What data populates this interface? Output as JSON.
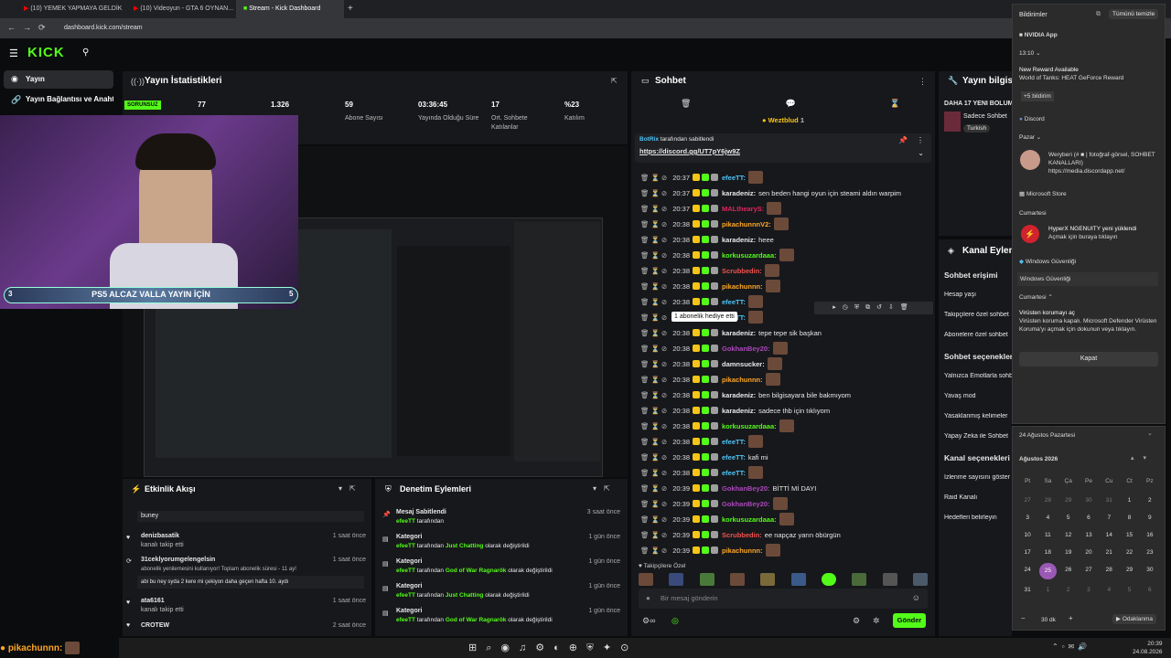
{
  "browser": {
    "tabs": [
      {
        "label": "(10) YEMEK YAPMAYA GELDİK"
      },
      {
        "label": "(10) Videoyun - GTA 6 OYNAN..."
      },
      {
        "label": "Stream - Kick Dashboard"
      }
    ],
    "url": "dashboard.kick.com/stream"
  },
  "sidebar": {
    "items": [
      {
        "label": "Yayın"
      },
      {
        "label": "Yayın Bağlantısı ve Anahtarı"
      }
    ]
  },
  "stats": {
    "title": "Yayın İstatistikleri",
    "status": "SORUNSUZ",
    "items": [
      {
        "value": "77",
        "label": ""
      },
      {
        "value": "1.326",
        "label": ""
      },
      {
        "value": "59",
        "label": "Abone Sayısı"
      },
      {
        "value": "03:36:45",
        "label": "Yayında Olduğu Süre"
      },
      {
        "value": "17",
        "label": "Ort. Sohbete Katılanlar"
      },
      {
        "value": "%23",
        "label": "Katılım"
      }
    ]
  },
  "overlay": {
    "goal_text": "PS5 ALCAZ VALLA YAYIN İÇİN",
    "goal_left": "3",
    "goal_right": "5"
  },
  "chat": {
    "title": "Sohbet",
    "top_user": "Weztblud",
    "top_count": "1",
    "pinned_by": "BotRix",
    "pinned_suffix": "tarafından sabitlendi",
    "pinned_link": "https://discord.gg/UT7pY6jw9Z",
    "tooltip": "1 abonelik hediye etti",
    "messages": [
      {
        "time": "20:37",
        "user": "efeeTT:",
        "color": "#4fc3f7",
        "text": "",
        "emote": true
      },
      {
        "time": "20:37",
        "user": "karadeniz:",
        "color": "#e8e8e8",
        "text": "sen beden hangi oyun için steami aldın warpim",
        "emote": false
      },
      {
        "time": "20:37",
        "user": "MALthearyS:",
        "color": "#e0245e",
        "text": "",
        "emote": true
      },
      {
        "time": "20:38",
        "user": "pikachunnnV2:",
        "color": "#ffa726",
        "text": "",
        "emote": true
      },
      {
        "time": "20:38",
        "user": "karadeniz:",
        "color": "#e8e8e8",
        "text": "heee",
        "emote": false
      },
      {
        "time": "20:38",
        "user": "korkusuzardaaa:",
        "color": "#53fc18",
        "text": "",
        "emote": true
      },
      {
        "time": "20:38",
        "user": "Scrubbedin:",
        "color": "#ef5350",
        "text": "",
        "emote": true
      },
      {
        "time": "20:38",
        "user": "pikachunnn:",
        "color": "#ffa726",
        "text": "",
        "emote": true
      },
      {
        "time": "20:38",
        "user": "efeeTT:",
        "color": "#4fc3f7",
        "text": "",
        "emote": true
      },
      {
        "time": "20:38",
        "user": "efeeTT:",
        "color": "#4fc3f7",
        "text": "",
        "emote": true
      },
      {
        "time": "20:38",
        "user": "karadeniz:",
        "color": "#e8e8e8",
        "text": "tepe tepe sik başkan",
        "emote": false
      },
      {
        "time": "20:38",
        "user": "GokhanBey20:",
        "color": "#ab47bc",
        "text": "",
        "emote": true
      },
      {
        "time": "20:38",
        "user": "damnsucker:",
        "color": "#e8e8e8",
        "text": "",
        "emote": true
      },
      {
        "time": "20:38",
        "user": "pikachunnn:",
        "color": "#ffa726",
        "text": "",
        "emote": true
      },
      {
        "time": "20:38",
        "user": "karadeniz:",
        "color": "#e8e8e8",
        "text": "ben bilgisayara bile bakmıyom",
        "emote": false
      },
      {
        "time": "20:38",
        "user": "karadeniz:",
        "color": "#e8e8e8",
        "text": "sadece thb için tıklıyom",
        "emote": false
      },
      {
        "time": "20:38",
        "user": "korkusuzardaaa:",
        "color": "#53fc18",
        "text": "",
        "emote": true
      },
      {
        "time": "20:38",
        "user": "efeeTT:",
        "color": "#4fc3f7",
        "text": "",
        "emote": true
      },
      {
        "time": "20:38",
        "user": "efeeTT:",
        "color": "#4fc3f7",
        "text": "kafi mi",
        "emote": false
      },
      {
        "time": "20:38",
        "user": "efeeTT:",
        "color": "#4fc3f7",
        "text": "",
        "emote": true
      },
      {
        "time": "20:39",
        "user": "GokhanBey20:",
        "color": "#ab47bc",
        "text": "BİTTİ Mİ DAYI",
        "emote": false
      },
      {
        "time": "20:39",
        "user": "GokhanBey20:",
        "color": "#ab47bc",
        "text": "",
        "emote": true
      },
      {
        "time": "20:39",
        "user": "korkusuzardaaa:",
        "color": "#53fc18",
        "text": "",
        "emote": true
      },
      {
        "time": "20:39",
        "user": "Scrubbedin:",
        "color": "#ef5350",
        "text": "ee napçaz yarın öbürgün",
        "emote": false
      },
      {
        "time": "20:39",
        "user": "pikachunnn:",
        "color": "#ffa726",
        "text": "",
        "emote": true
      }
    ],
    "emote_bar_label": "Takipçilere Özel",
    "input_placeholder": "Bir mesaj gönderin",
    "send": "Gönder"
  },
  "info": {
    "title": "Yayın bilgisi",
    "line": "DAHA 17 YENİ BÖLÜM",
    "sub": "Sadece Sohbet",
    "lang": "Turkish"
  },
  "channel": {
    "title": "Kanal Eylemleri",
    "sections": [
      {
        "h": "Sohbet erişimi"
      },
      {
        "i": "Hesap yaşı"
      },
      {
        "i": "Takipçilere özel sohbet"
      },
      {
        "i": "Abonelere özel sohbet"
      },
      {
        "h": "Sohbet seçenekleri"
      },
      {
        "i": "Yalnızca Emotlarla sohbet"
      },
      {
        "i": "Yavaş mod"
      },
      {
        "i": "Yasaklanmış kelimeler"
      },
      {
        "i": "Yapay Zeka ile Sohbet"
      },
      {
        "h": "Kanal seçenekleri"
      },
      {
        "i": "İzlenme sayısını göster"
      },
      {
        "i": "Raid Kanalı"
      },
      {
        "i": "Hedefleri belirleyin"
      }
    ]
  },
  "feed": {
    "title": "Etkinlik Akışı",
    "items": [
      {
        "name": "buney",
        "sub": "",
        "time": ""
      },
      {
        "name": "denizbasatik",
        "sub": "kanalı takip etti",
        "time": "1 saat önce"
      },
      {
        "name": "31ceklyorumgelengelsin",
        "sub": "abonelik yenilemesini kullanıyor! Toplam abonelik süresi - 11 ay!",
        "time": "1 saat önce",
        "note": "abi bu ney syda 2 kere mi çekiyon daha geçen hafta 10. aydı"
      },
      {
        "name": "ata6161",
        "sub": "kanalı takip etti",
        "time": "1 saat önce"
      },
      {
        "name": "CROTEW",
        "sub": "",
        "time": "2 saat önce"
      }
    ]
  },
  "mod": {
    "title": "Denetim Eylemleri",
    "items": [
      {
        "title": "Mesaj Sabitlendi",
        "user": "efeeTT",
        "rest": "tarafından",
        "cat": "",
        "tail": "",
        "time": "3 saat önce"
      },
      {
        "title": "Kategori",
        "user": "efeeTT",
        "rest": "tarafından",
        "cat": "Just Chatting",
        "tail": "olarak değiştirildi",
        "time": "1 gün önce"
      },
      {
        "title": "Kategori",
        "user": "efeeTT",
        "rest": "tarafından",
        "cat": "God of War Ragnarök",
        "tail": "olarak değiştirildi",
        "time": "1 gün önce"
      },
      {
        "title": "Kategori",
        "user": "efeeTT",
        "rest": "tarafından",
        "cat": "Just Chatting",
        "tail": "olarak değiştirildi",
        "time": "1 gün önce"
      },
      {
        "title": "Kategori",
        "user": "efeeTT",
        "rest": "tarafından",
        "cat": "God of War Ragnarök",
        "tail": "olarak değiştirildi",
        "time": "1 gün önce"
      }
    ]
  },
  "notifications": {
    "title": "Bildirimler",
    "clear": "Tümünü temizle",
    "nvidia": "NVIDIA App",
    "nvidia_time": "13:10",
    "reward_title": "New Reward Available",
    "reward_body": "World of Tanks: HEAT GeForce Reward",
    "more": "+5 bildirim",
    "discord": "Discord",
    "pazar": "Pazar",
    "dc_user": "Weryberi (# ■ | fotoğraf-görsel, SOHBET KANALLARI)",
    "dc_link": "https://media.discordapp.net/",
    "store": "Microsoft Store",
    "cumartesi": "Cumartesi",
    "hyperx": "HyperX NGENUITY yeni yüklendi",
    "hyperx_sub": "Açmak için buraya tıklayın",
    "winsec": "Windows Güvenliği",
    "winsec2": "Windows Güvenliği",
    "cumartesi2": "Cumartesi",
    "virus_title": "Virüsten korumayı aç",
    "virus_body": "Virüsten koruma kapalı. Microsoft Defender Virüsten Koruma'yı açmak için dokunun veya tıklayın.",
    "close": "Kapat"
  },
  "calendar": {
    "date_header": "24 Ağustos Pazartesi",
    "month": "Ağustos 2026",
    "weekdays": [
      "Pt",
      "Sa",
      "Ça",
      "Pe",
      "Cu",
      "Ct",
      "Pz"
    ],
    "days": [
      "27",
      "28",
      "29",
      "30",
      "31",
      "1",
      "2",
      "3",
      "4",
      "5",
      "6",
      "7",
      "8",
      "9",
      "10",
      "11",
      "12",
      "13",
      "14",
      "15",
      "16",
      "17",
      "18",
      "19",
      "20",
      "21",
      "22",
      "23",
      "24",
      "25",
      "26",
      "27",
      "28",
      "29",
      "30",
      "31",
      "1",
      "2",
      "3",
      "4",
      "5",
      "6"
    ],
    "today": "24",
    "focus_min": "30 dk",
    "focus": "Odaklanma"
  },
  "bottom": {
    "ticker_user": "pikachunnn:"
  },
  "taskbar": {
    "time": "20:39",
    "date": "24.08.2026"
  }
}
